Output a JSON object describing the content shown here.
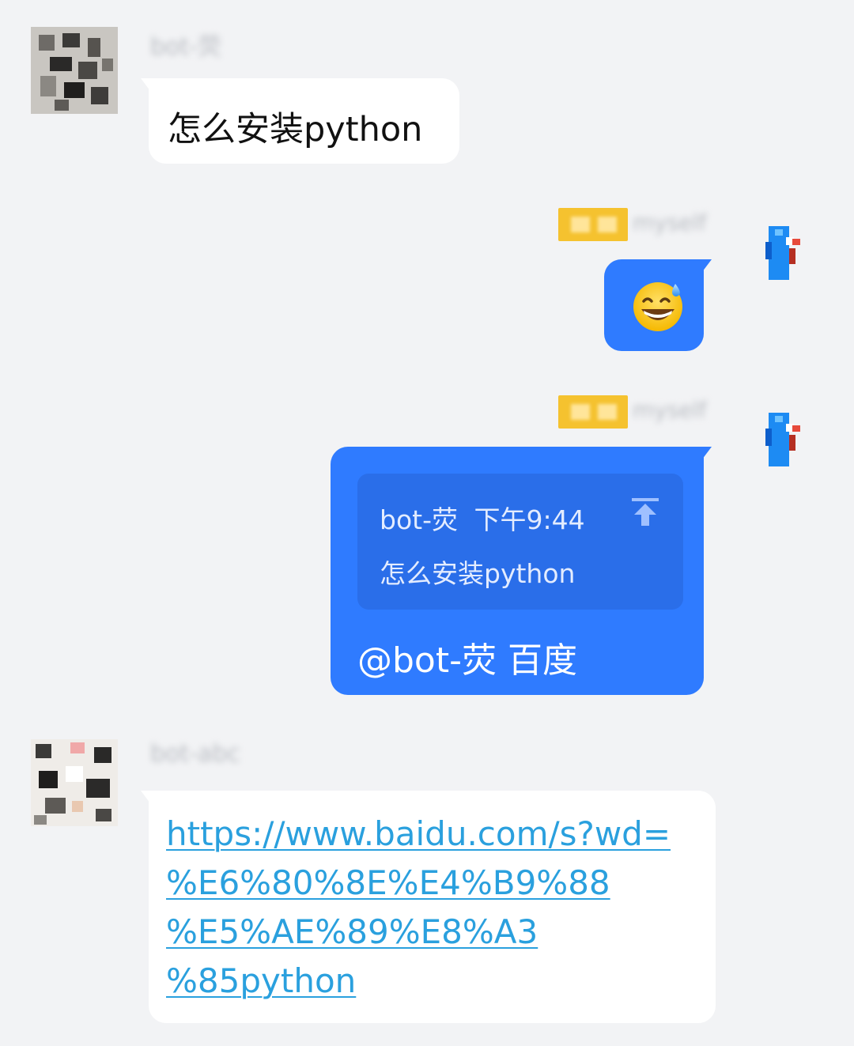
{
  "conversation": {
    "messages": [
      {
        "sender": "bot-荧",
        "side": "left",
        "type": "text",
        "text": "怎么安装python"
      },
      {
        "sender": "myself",
        "badge": "群主",
        "side": "right",
        "type": "emoji",
        "emoji": "grinning-face-with-sweat"
      },
      {
        "sender": "myself",
        "badge": "群主",
        "side": "right",
        "type": "reply",
        "quote": {
          "author": "bot-荧",
          "time": "下午9:44",
          "text": "怎么安装python"
        },
        "text": "@bot-荧 百度"
      },
      {
        "sender": "bot-abc",
        "side": "left",
        "type": "link",
        "link_lines": [
          "https://www.baidu.com/s?wd=",
          "%E6%80%8E%E4%B9%88",
          "%E5%AE%89%E8%A3",
          "%85python"
        ]
      }
    ]
  },
  "colors": {
    "background": "#f2f3f5",
    "bubble_incoming": "#ffffff",
    "bubble_outgoing": "#2f7bff",
    "quote_block": "#2a6ee9",
    "link": "#2aa0de",
    "badge": "#f5c22f"
  }
}
